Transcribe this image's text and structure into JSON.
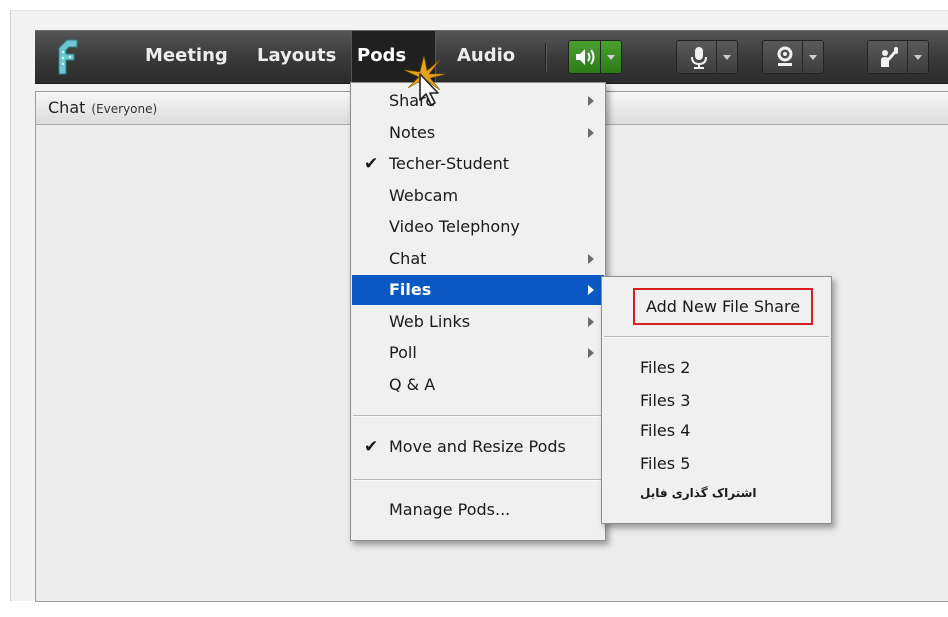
{
  "menubar": {
    "items": [
      "Meeting",
      "Layouts",
      "Pods",
      "Audio"
    ],
    "active": "Pods",
    "tools": [
      "speaker-icon",
      "microphone-icon",
      "webcam-icon",
      "raise-hand-icon"
    ]
  },
  "chat_pod": {
    "title": "Chat",
    "subtitle": "(Everyone)"
  },
  "pods_menu": {
    "items": [
      {
        "label": "Share",
        "submenu": true
      },
      {
        "label": "Notes",
        "submenu": true
      },
      {
        "label": "Techer-Student",
        "checked": true
      },
      {
        "label": "Webcam"
      },
      {
        "label": "Video Telephony"
      },
      {
        "label": "Chat",
        "submenu": true
      },
      {
        "label": "Files",
        "submenu": true,
        "highlighted": true
      },
      {
        "label": "Web Links",
        "submenu": true
      },
      {
        "label": "Poll",
        "submenu": true
      },
      {
        "label": "Q & A"
      }
    ],
    "move_resize": {
      "label": "Move and Resize Pods",
      "checked": true
    },
    "manage": {
      "label": "Manage Pods..."
    }
  },
  "files_menu": {
    "add_new": "Add New File Share",
    "items": [
      "Files 2",
      "Files 3",
      "Files 4",
      "Files 5",
      "اشتراک گذاری فایل"
    ]
  },
  "colors": {
    "highlight": "#0b57c3",
    "callout_border": "#d6201f",
    "speaker_active": "#3a8f22"
  }
}
